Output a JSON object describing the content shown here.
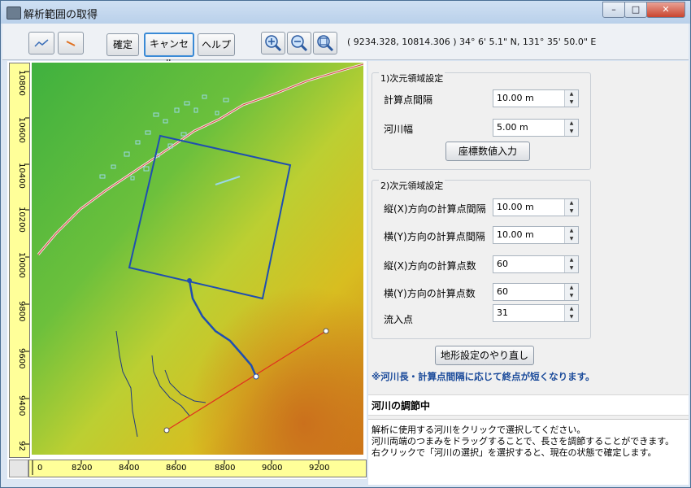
{
  "window": {
    "title": "解析範囲の取得",
    "min": "–",
    "max": "□",
    "close": "✕"
  },
  "toolbar": {
    "confirm": "確定",
    "cancel": "キャンセル",
    "help": "ヘルプ",
    "coords": "( 9234.328, 10814.306 )   34° 6' 5.1\" N, 131° 35' 50.0\" E"
  },
  "ruler": {
    "y_labels": [
      "10800",
      "10600",
      "10400",
      "10200",
      "10000",
      "9800",
      "9600",
      "9400",
      "92"
    ],
    "x_labels": [
      "0",
      "8200",
      "8400",
      "8600",
      "8800",
      "9000",
      "9200"
    ]
  },
  "panel": {
    "group1": {
      "title": "1)次元領域設定",
      "spacing_label": "計算点間隔",
      "spacing_value": "10.00 m",
      "width_label": "河川幅",
      "width_value": "5.00 m",
      "coord_button": "座標数値入力"
    },
    "group2": {
      "title": "2)次元領域設定",
      "x_spacing_label": "縦(X)方向の計算点間隔",
      "x_spacing_value": "10.00 m",
      "y_spacing_label": "横(Y)方向の計算点間隔",
      "y_spacing_value": "10.00 m",
      "x_count_label": "縦(X)方向の計算点数",
      "x_count_value": "60",
      "y_count_label": "横(Y)方向の計算点数",
      "y_count_value": "60",
      "inflow_label": "流入点",
      "inflow_value": "31"
    },
    "redo_button": "地形設定のやり直し",
    "note": "※河川長・計算点間隔に応じて終点が短くなります。",
    "status": "河川の調節中",
    "help_lines": [
      "解析に使用する河川をクリックで選択してください。",
      "河川両端のつまみをドラッグすることで、長さを調節することができます。",
      "右クリックで「河川の選択」を選択すると、現在の状態で確定します。"
    ]
  },
  "colors": {
    "accent": "#3a8ad6",
    "note": "#1a4a9a",
    "region": "#1f4fb0",
    "river_line": "#e03020"
  }
}
